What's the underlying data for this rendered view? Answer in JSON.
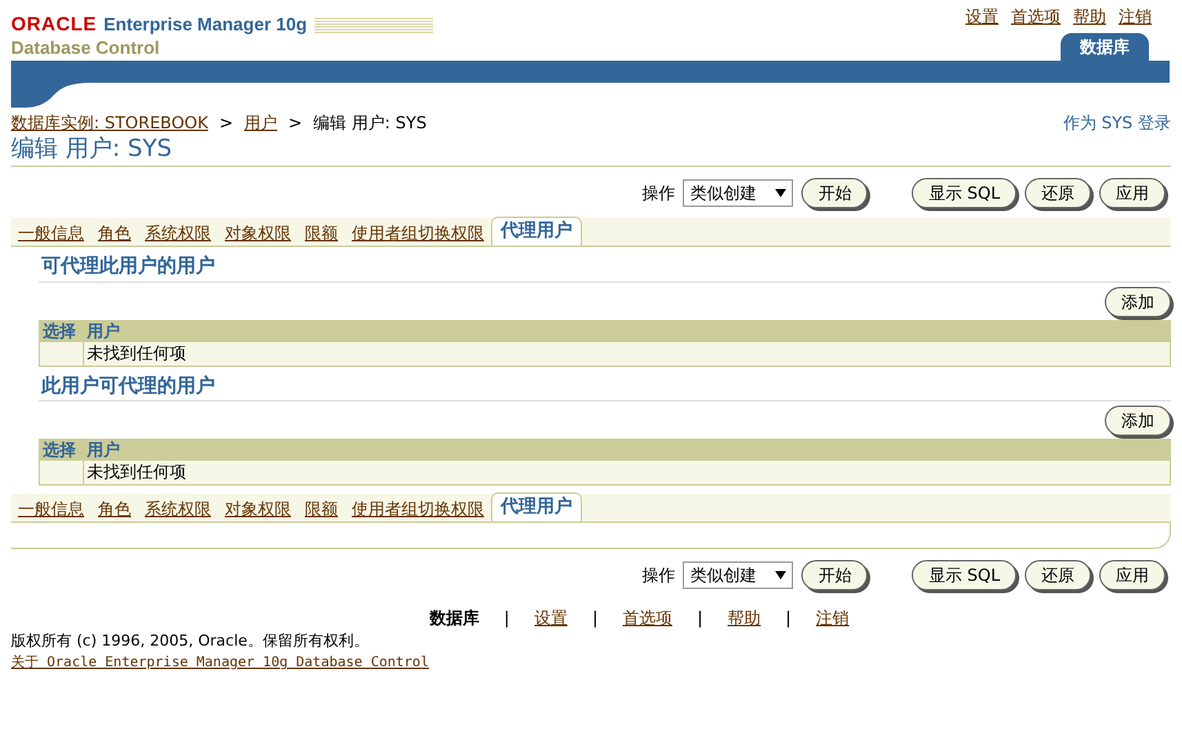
{
  "header": {
    "logo": "ORACLE",
    "product": "Enterprise Manager 10g",
    "subtitle": "Database Control",
    "global_links": [
      "设置",
      "首选项",
      "帮助",
      "注销"
    ],
    "tabs": [
      {
        "label": "数据库",
        "selected": true
      }
    ]
  },
  "breadcrumb": [
    {
      "label": "数据库实例: STOREBOOK",
      "kind": "link"
    },
    {
      "label": ">",
      "kind": "separator"
    },
    {
      "label": "用户",
      "kind": "link"
    },
    {
      "label": ">",
      "kind": "separator"
    },
    {
      "label": "编辑 用户: SYS",
      "kind": "current"
    }
  ],
  "login_info": "作为 SYS 登录",
  "page_title": "编辑 用户: SYS",
  "top_actions": {
    "label": "操作",
    "select_value": "类似创建",
    "go_button": "开始",
    "buttons": [
      "显示 SQL",
      "还原",
      "应用"
    ]
  },
  "tabs_top": [
    {
      "label": "一般信息",
      "selected": false
    },
    {
      "label": "角色",
      "selected": false
    },
    {
      "label": "系统权限",
      "selected": false
    },
    {
      "label": "对象权限",
      "selected": false
    },
    {
      "label": "限额",
      "selected": false
    },
    {
      "label": "使用者组切换权限",
      "selected": false
    },
    {
      "label": "代理用户",
      "selected": true
    }
  ],
  "sections": [
    {
      "title": "可代理此用户的用户",
      "add_button": "添加",
      "columns": [
        "选择",
        "用户"
      ],
      "empty_text": "未找到任何项"
    },
    {
      "title": "此用户可代理的用户",
      "add_button": "添加",
      "columns": [
        "选择",
        "用户"
      ],
      "empty_text": "未找到任何项"
    }
  ],
  "tabs_bottom": [
    {
      "label": "一般信息",
      "selected": false
    },
    {
      "label": "角色",
      "selected": false
    },
    {
      "label": "系统权限",
      "selected": false
    },
    {
      "label": "对象权限",
      "selected": false
    },
    {
      "label": "限额",
      "selected": false
    },
    {
      "label": "使用者组切换权限",
      "selected": false
    },
    {
      "label": "代理用户",
      "selected": true
    }
  ],
  "bottom_actions": {
    "label": "操作",
    "select_value": "类似创建",
    "go_button": "开始",
    "buttons": [
      "显示 SQL",
      "还原",
      "应用"
    ]
  },
  "footer": {
    "items": [
      {
        "label": "数据库",
        "kind": "current"
      },
      {
        "label": "|",
        "kind": "separator"
      },
      {
        "label": "设置",
        "kind": "link"
      },
      {
        "label": "|",
        "kind": "separator"
      },
      {
        "label": "首选项",
        "kind": "link"
      },
      {
        "label": "|",
        "kind": "separator"
      },
      {
        "label": "帮助",
        "kind": "link"
      },
      {
        "label": "|",
        "kind": "separator"
      },
      {
        "label": "注销",
        "kind": "link"
      }
    ],
    "copyright": "版权所有 (c) 1996, 2005, Oracle。保留所有权利。",
    "about_link": "关于 Oracle Enterprise Manager 10g Database Control"
  }
}
